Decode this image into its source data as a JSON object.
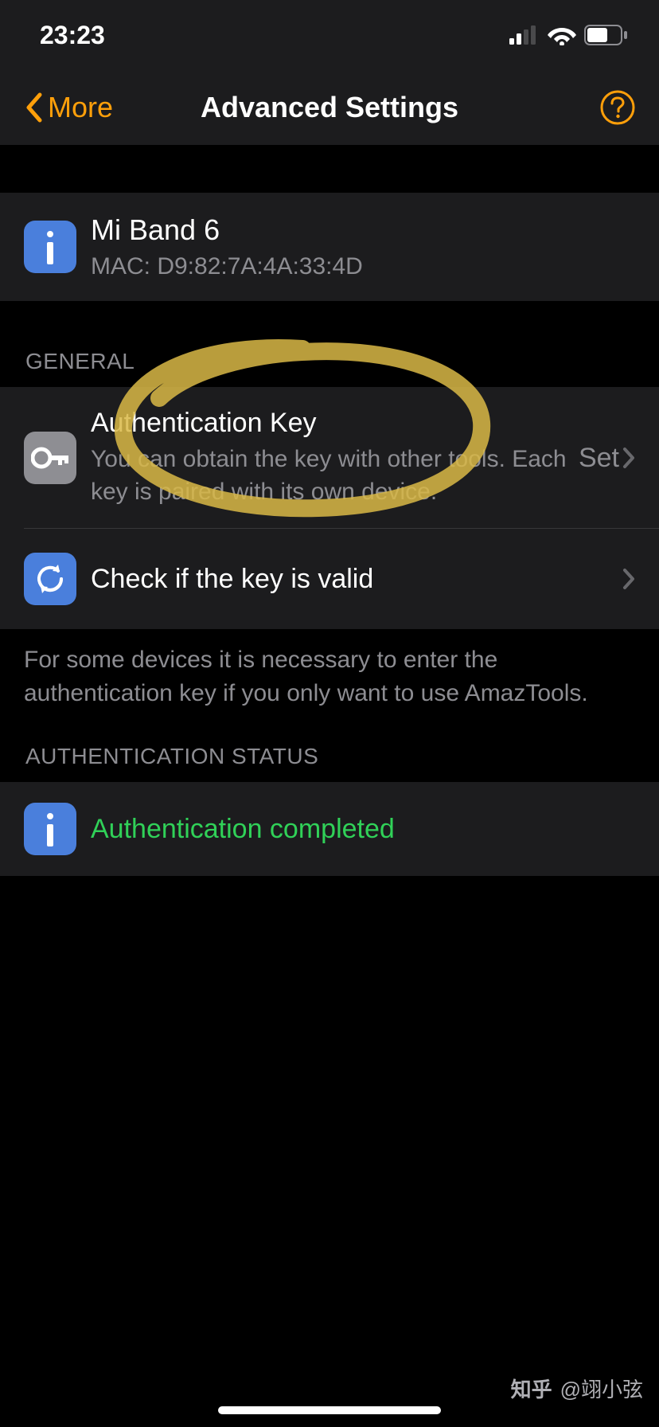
{
  "status": {
    "time": "23:23"
  },
  "nav": {
    "back_label": "More",
    "title": "Advanced Settings"
  },
  "device": {
    "name": "Mi Band 6",
    "mac_label": "MAC: D9:82:7A:4A:33:4D"
  },
  "sections": {
    "general": {
      "header": "GENERAL",
      "auth_key": {
        "title": "Authentication Key",
        "subtitle": "You can obtain the key with other tools. Each key is paired with its own device.",
        "value": "Set"
      },
      "check_key": {
        "title": "Check if the key is valid"
      },
      "footer": "For some devices it is necessary to enter the authentication key if you only want to use AmazTools."
    },
    "auth_status": {
      "header": "AUTHENTICATION STATUS",
      "text": "Authentication completed"
    }
  },
  "watermark": {
    "brand": "知乎",
    "user": "@翊小弦"
  }
}
